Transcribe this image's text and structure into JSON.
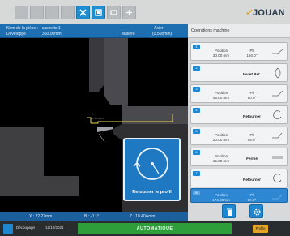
{
  "brand": {
    "logo_text": "JOUAN",
    "colors": {
      "accent": "#1f86d0",
      "status_green": "#2e9e3b",
      "panel": "#d8d9da",
      "profile_yellow": "#e4cf3a"
    }
  },
  "toolbar": {
    "icons": [
      "tool-icon-1",
      "tool-icon-2",
      "tool-icon-3",
      "tool-icon-4",
      "cross-tool-icon",
      "bend-tool-icon",
      "square-tool-icon",
      "settings-tool-icon"
    ]
  },
  "part_info": {
    "name_label": "Nom de la pièce :",
    "name_value": "cassette 1",
    "developed_label": "Développé",
    "developed_value": "360.00mm",
    "material_label": "Matière",
    "material_name": "Acier",
    "material_thickness": "(0.508mm)"
  },
  "coordinates": {
    "x": "X : 22.27mm",
    "b": "B : -0.1°",
    "z": "Z : 18.40Amm"
  },
  "overlay": {
    "label": "Retourner le profil"
  },
  "operations": {
    "title": "Opérations machine",
    "items": [
      {
        "num": "1",
        "c1": "Position",
        "c1v": "30.00 mm",
        "c2": "Pli",
        "c2v": "150.0°",
        "icon": "bend-angle-icon"
      },
      {
        "num": "2",
        "c1": "",
        "c1v": "",
        "c2": "Inv et Ret.",
        "c2v": "",
        "icon": "invert-return-icon"
      },
      {
        "num": "3",
        "c1": "Position",
        "c1v": "45.00 mm",
        "c2": "Pli",
        "c2v": "90.0°",
        "icon": "bend-angle-icon"
      },
      {
        "num": "4",
        "c1": "",
        "c1v": "",
        "c2": "Retourner",
        "c2v": "",
        "icon": "rotate-icon"
      },
      {
        "num": "5",
        "c1": "Position",
        "c1v": "20.00 mm",
        "c2": "Pli",
        "c2v": "95.0°",
        "icon": "bend-angle-icon"
      },
      {
        "num": "6",
        "c1": "Position",
        "c1v": "15.00 mm",
        "c2": "Fermé",
        "c2v": "",
        "icon": "closed-bend-icon"
      },
      {
        "num": "7",
        "c1": "",
        "c1v": "",
        "c2": "Retourner",
        "c2v": "",
        "icon": "rotate-icon"
      },
      {
        "num": "8",
        "c1": "Position",
        "c1v": "174.00mm",
        "c2": "Pli",
        "c2v": "90.0°",
        "icon": "bend-angle-icon",
        "selected": true
      }
    ]
  },
  "bottom_actions": {
    "delete_icon": "trash-icon",
    "settings_icon": "gear-icon"
  },
  "status": {
    "mode_label": "Découpage",
    "date": "12/10/2021",
    "mode": "AUTOMATIQUE",
    "profile_badge": "Profile"
  }
}
